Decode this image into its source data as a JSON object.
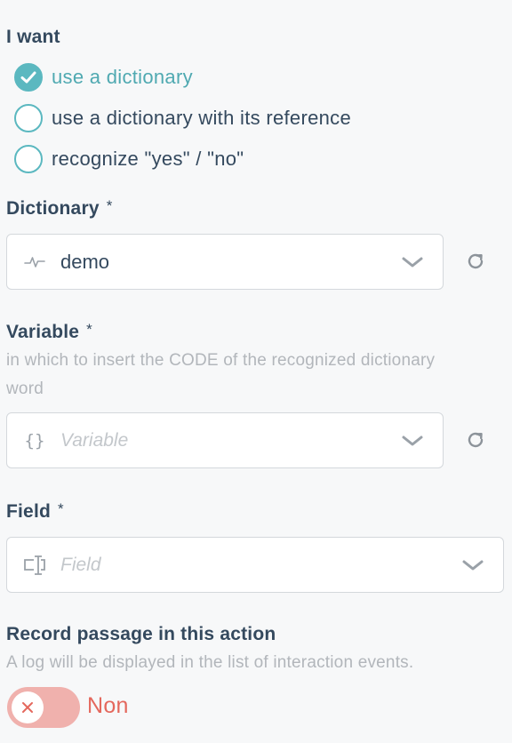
{
  "i_want": {
    "title": "I want",
    "options": [
      {
        "label": "use a dictionary",
        "selected": true
      },
      {
        "label": "use a dictionary with its reference",
        "selected": false
      },
      {
        "label": "recognize \"yes\" / \"no\"",
        "selected": false
      }
    ]
  },
  "dictionary": {
    "label": "Dictionary",
    "required_mark": "*",
    "value": "demo",
    "lead_icon": "pulse-icon",
    "chevron_icon": "chevron-down-icon",
    "refresh_icon": "refresh-icon"
  },
  "variable": {
    "label": "Variable",
    "required_mark": "*",
    "help": "in which to insert the CODE of the recognized dictionary word",
    "placeholder": "Variable",
    "lead_icon": "curly-braces-icon",
    "lead_text": "{}",
    "chevron_icon": "chevron-down-icon",
    "refresh_icon": "refresh-icon"
  },
  "field": {
    "label": "Field",
    "required_mark": "*",
    "placeholder": "Field",
    "lead_icon": "text-field-icon",
    "chevron_icon": "chevron-down-icon"
  },
  "record": {
    "title": "Record passage in this action",
    "help": "A log will be displayed in the list of interaction events.",
    "toggle_label": "Non",
    "toggle_on": false
  },
  "colors": {
    "accent": "#5bb8c0",
    "accent_text": "#4fa9b1",
    "heading": "#34495e",
    "help": "#b2b6bb",
    "toggle_off_bg": "#f0b1ad",
    "toggle_off_text": "#e4685d"
  }
}
